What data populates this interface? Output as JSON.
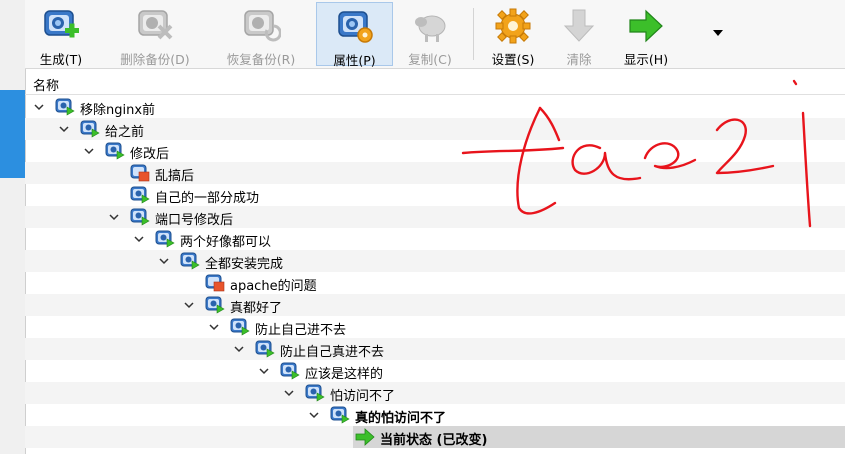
{
  "toolbar": {
    "buttons": [
      {
        "label": "生成(T)",
        "icon": "snapshot-take-icon",
        "enabled": true
      },
      {
        "label": "删除备份(D)",
        "icon": "snapshot-delete-icon",
        "enabled": false
      },
      {
        "label": "恢复备份(R)",
        "icon": "snapshot-restore-icon",
        "enabled": false
      },
      {
        "label": "属性(P)",
        "icon": "snapshot-properties-icon",
        "enabled": true,
        "active": true
      },
      {
        "label": "复制(C)",
        "icon": "sheep-clone-icon",
        "enabled": false
      },
      {
        "label": "设置(S)",
        "icon": "gear-icon",
        "enabled": true
      },
      {
        "label": "清除",
        "icon": "discard-arrow-down-icon",
        "enabled": false
      },
      {
        "label": "显示(H)",
        "icon": "show-arrow-right-icon",
        "enabled": true
      }
    ]
  },
  "list": {
    "column_header": "名称",
    "items": [
      {
        "label": "移除nginx前"
      },
      {
        "label": "给之前"
      },
      {
        "label": "修改后"
      },
      {
        "label": "乱搞后"
      },
      {
        "label": "自己的一部分成功"
      },
      {
        "label": "端口号修改后"
      },
      {
        "label": "两个好像都可以"
      },
      {
        "label": "全都安装完成"
      },
      {
        "label": "apache的问题"
      },
      {
        "label": "真都好了"
      },
      {
        "label": "防止自己进不去"
      },
      {
        "label": "防止自己真进不去"
      },
      {
        "label": "应该是这样的"
      },
      {
        "label": "怕访问不了"
      },
      {
        "label": "真的怕访问不了"
      },
      {
        "label": "当前状态 (已改变)"
      }
    ]
  },
  "colors": {
    "accent": "#2c8fe0",
    "selection_gray": "#d6d6d6",
    "scribble_red": "#e8141c"
  }
}
